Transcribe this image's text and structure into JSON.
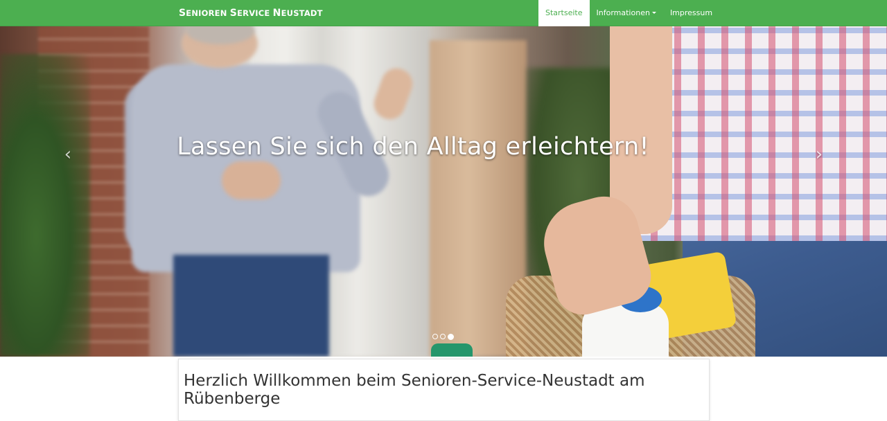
{
  "navbar": {
    "brand_parts": [
      {
        "text": "S",
        "size": "big"
      },
      {
        "text": "ENIOREN ",
        "size": "small"
      },
      {
        "text": "S",
        "size": "big"
      },
      {
        "text": "ERVICE ",
        "size": "small"
      },
      {
        "text": "N",
        "size": "big"
      },
      {
        "text": "EUSTADT",
        "size": "small"
      }
    ],
    "items": [
      {
        "label": "Startseite",
        "active": true
      },
      {
        "label": "Informationen",
        "dropdown": true
      },
      {
        "label": "Impressum"
      }
    ]
  },
  "carousel": {
    "caption": "Lassen Sie sich den Alltag erleichtern!",
    "prev_icon": "chevron-left-icon",
    "next_icon": "chevron-right-icon",
    "slide_count": 3,
    "active_index": 2
  },
  "main": {
    "heading_line1": "Herzlich Willkommen beim Senioren-Service-Neustadt am",
    "heading_line2": "Rübenberge"
  },
  "colors": {
    "primary": "#4caf50",
    "text": "#333333"
  }
}
